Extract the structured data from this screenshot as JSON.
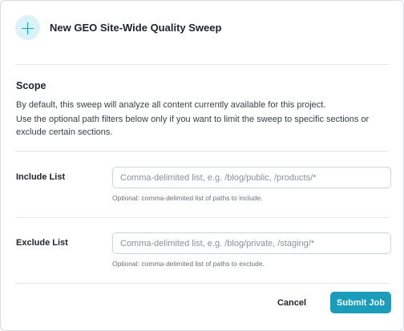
{
  "header": {
    "title": "New GEO Site-Wide Quality Sweep",
    "icon": "plus-icon",
    "icon_glyph": "+",
    "icon_color": "#1aa7c3",
    "icon_bg": "#d9f3f8"
  },
  "scope": {
    "heading": "Scope",
    "line1": "By default, this sweep will analyze all content currently available for this project.",
    "line2": "Use the optional path filters below only if you want to limit the sweep to specific sections or exclude certain sections."
  },
  "include": {
    "label": "Include List",
    "placeholder": "Comma-delimited list, e.g. /blog/public, /products/*",
    "value": "",
    "help": "Optional: comma-delimited list of paths to include."
  },
  "exclude": {
    "label": "Exclude List",
    "placeholder": "Comma-delimited list, e.g. /blog/private, /staging/*",
    "value": "",
    "help": "Optional: comma-delimited list of paths to exclude."
  },
  "footer": {
    "cancel_label": "Cancel",
    "submit_label": "Submit Job"
  },
  "colors": {
    "accent": "#1a9dbb"
  }
}
